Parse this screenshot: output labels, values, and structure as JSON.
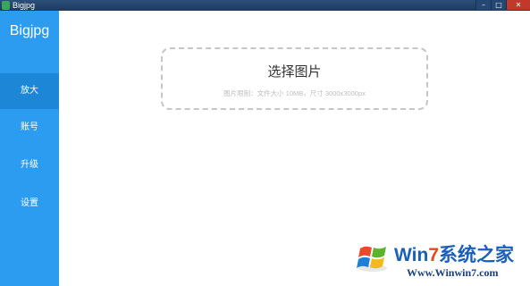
{
  "window": {
    "title": "Bigjpg"
  },
  "sidebar": {
    "brand": "Bigjpg",
    "items": [
      {
        "label": "放大",
        "active": true
      },
      {
        "label": "账号",
        "active": false
      },
      {
        "label": "升级",
        "active": false
      },
      {
        "label": "设置",
        "active": false
      }
    ]
  },
  "upload": {
    "title": "选择图片",
    "hint": "图片限制：文件大小 10MB，尺寸 3000x3000px"
  },
  "watermark": {
    "brand_prefix": "Win",
    "brand_seven": "7",
    "brand_suffix": "系统之家",
    "url": "Www.Winwin7.com"
  },
  "colors": {
    "sidebar_bg": "#2c9cf0",
    "sidebar_active": "#1e86d6",
    "dashed_border": "#c6c6c6"
  }
}
